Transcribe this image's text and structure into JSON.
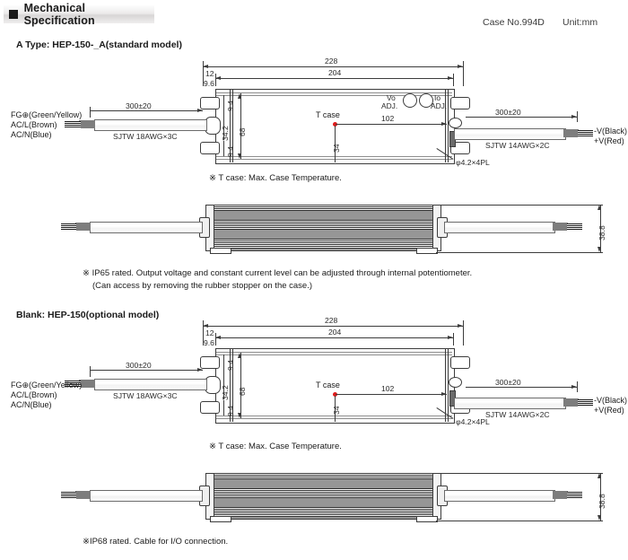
{
  "header": {
    "title": "Mechanical Specification",
    "bullet_icon": "black-square-bullet",
    "case_no": "Case No.994D",
    "unit": "Unit:mm"
  },
  "sections": [
    {
      "id": "type-a",
      "title": "A Type: HEP-150-_A(standard model)",
      "top_view": {
        "dims": {
          "overall_length": "228",
          "body_length": "204",
          "bracket_offset": "12",
          "bracket_edge": "9.6",
          "mount_top": "9.4",
          "mount_span": "34.2",
          "mount_bottom": "9.4",
          "width": "68",
          "tcase_x": "102",
          "tcase_y": "34"
        },
        "tcase_label": "T case",
        "adjust": {
          "vo_line1": "Vo",
          "vo_line2": "ADJ.",
          "io_line1": "Io",
          "io_line2": "ADJ."
        },
        "hole_note": "φ4.2×4PL",
        "input": {
          "length": "300±20",
          "cable": "SJTW 18AWG×3C",
          "wires": [
            "FG⊕(Green/Yellow)",
            "AC/L(Brown)",
            "AC/N(Blue)"
          ]
        },
        "output": {
          "length": "300±20",
          "cable": "SJTW 14AWG×2C",
          "wires": [
            "-V(Black)",
            "+V(Red)"
          ]
        }
      },
      "tcase_note": "※ T case: Max. Case Temperature.",
      "side_view": {
        "height": "38.8"
      },
      "notes": [
        "※ IP65 rated. Output voltage and constant current level can be adjusted through internal potentiometer.",
        "(Can access by removing the rubber stopper on the case.)"
      ]
    },
    {
      "id": "type-blank",
      "title": "Blank: HEP-150(optional model)",
      "top_view": {
        "dims": {
          "overall_length": "228",
          "body_length": "204",
          "bracket_offset": "12",
          "bracket_edge": "9.6",
          "mount_top": "9.4",
          "mount_span": "34.2",
          "mount_bottom": "9.4",
          "width": "68",
          "tcase_x": "102",
          "tcase_y": "34"
        },
        "tcase_label": "T case",
        "hole_note": "φ4.2×4PL",
        "input": {
          "length": "300±20",
          "cable": "SJTW 18AWG×3C",
          "wires": [
            "FG⊕(Green/Yellow)",
            "AC/L(Brown)",
            "AC/N(Blue)"
          ]
        },
        "output": {
          "length": "300±20",
          "cable": "SJTW 14AWG×2C",
          "wires": [
            "-V(Black)",
            "+V(Red)"
          ]
        }
      },
      "tcase_note": "※ T case: Max. Case Temperature.",
      "side_view": {
        "height": "38.8"
      },
      "notes": [
        "※IP68 rated. Cable for I/O connection."
      ]
    }
  ],
  "colors": {
    "line": "#3c3c3c",
    "text": "#1a1a1a",
    "tcase_dot": "#e01b1b",
    "header_bg": "#e6e4e4"
  }
}
